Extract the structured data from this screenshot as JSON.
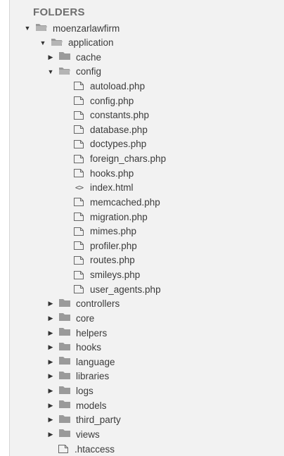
{
  "sidebar": {
    "header": "FOLDERS",
    "root": {
      "label": "moenzarlawfirm",
      "expanded": true
    },
    "application": {
      "label": "application",
      "expanded": true
    },
    "cache": {
      "label": "cache"
    },
    "config": {
      "label": "config",
      "expanded": true,
      "files": [
        {
          "label": "autoload.php",
          "icon": "file-icon"
        },
        {
          "label": "config.php",
          "icon": "file-icon"
        },
        {
          "label": "constants.php",
          "icon": "file-icon"
        },
        {
          "label": "database.php",
          "icon": "file-icon"
        },
        {
          "label": "doctypes.php",
          "icon": "file-icon"
        },
        {
          "label": "foreign_chars.php",
          "icon": "file-icon"
        },
        {
          "label": "hooks.php",
          "icon": "file-icon"
        },
        {
          "label": "index.html",
          "icon": "code-icon"
        },
        {
          "label": "memcached.php",
          "icon": "file-icon"
        },
        {
          "label": "migration.php",
          "icon": "file-icon"
        },
        {
          "label": "mimes.php",
          "icon": "file-icon"
        },
        {
          "label": "profiler.php",
          "icon": "file-icon"
        },
        {
          "label": "routes.php",
          "icon": "file-icon"
        },
        {
          "label": "smileys.php",
          "icon": "file-icon"
        },
        {
          "label": "user_agents.php",
          "icon": "file-icon"
        }
      ]
    },
    "folders": [
      {
        "label": "controllers"
      },
      {
        "label": "core"
      },
      {
        "label": "helpers"
      },
      {
        "label": "hooks"
      },
      {
        "label": "language"
      },
      {
        "label": "libraries"
      },
      {
        "label": "logs"
      },
      {
        "label": "models"
      },
      {
        "label": "third_party"
      },
      {
        "label": "views"
      }
    ],
    "trailing": {
      "label": ".htaccess"
    }
  },
  "colors": {
    "panel_bg": "#f2f2f2",
    "folder": "#9a9a9a",
    "text": "#3b3b3b",
    "header": "#6e6e6e"
  }
}
